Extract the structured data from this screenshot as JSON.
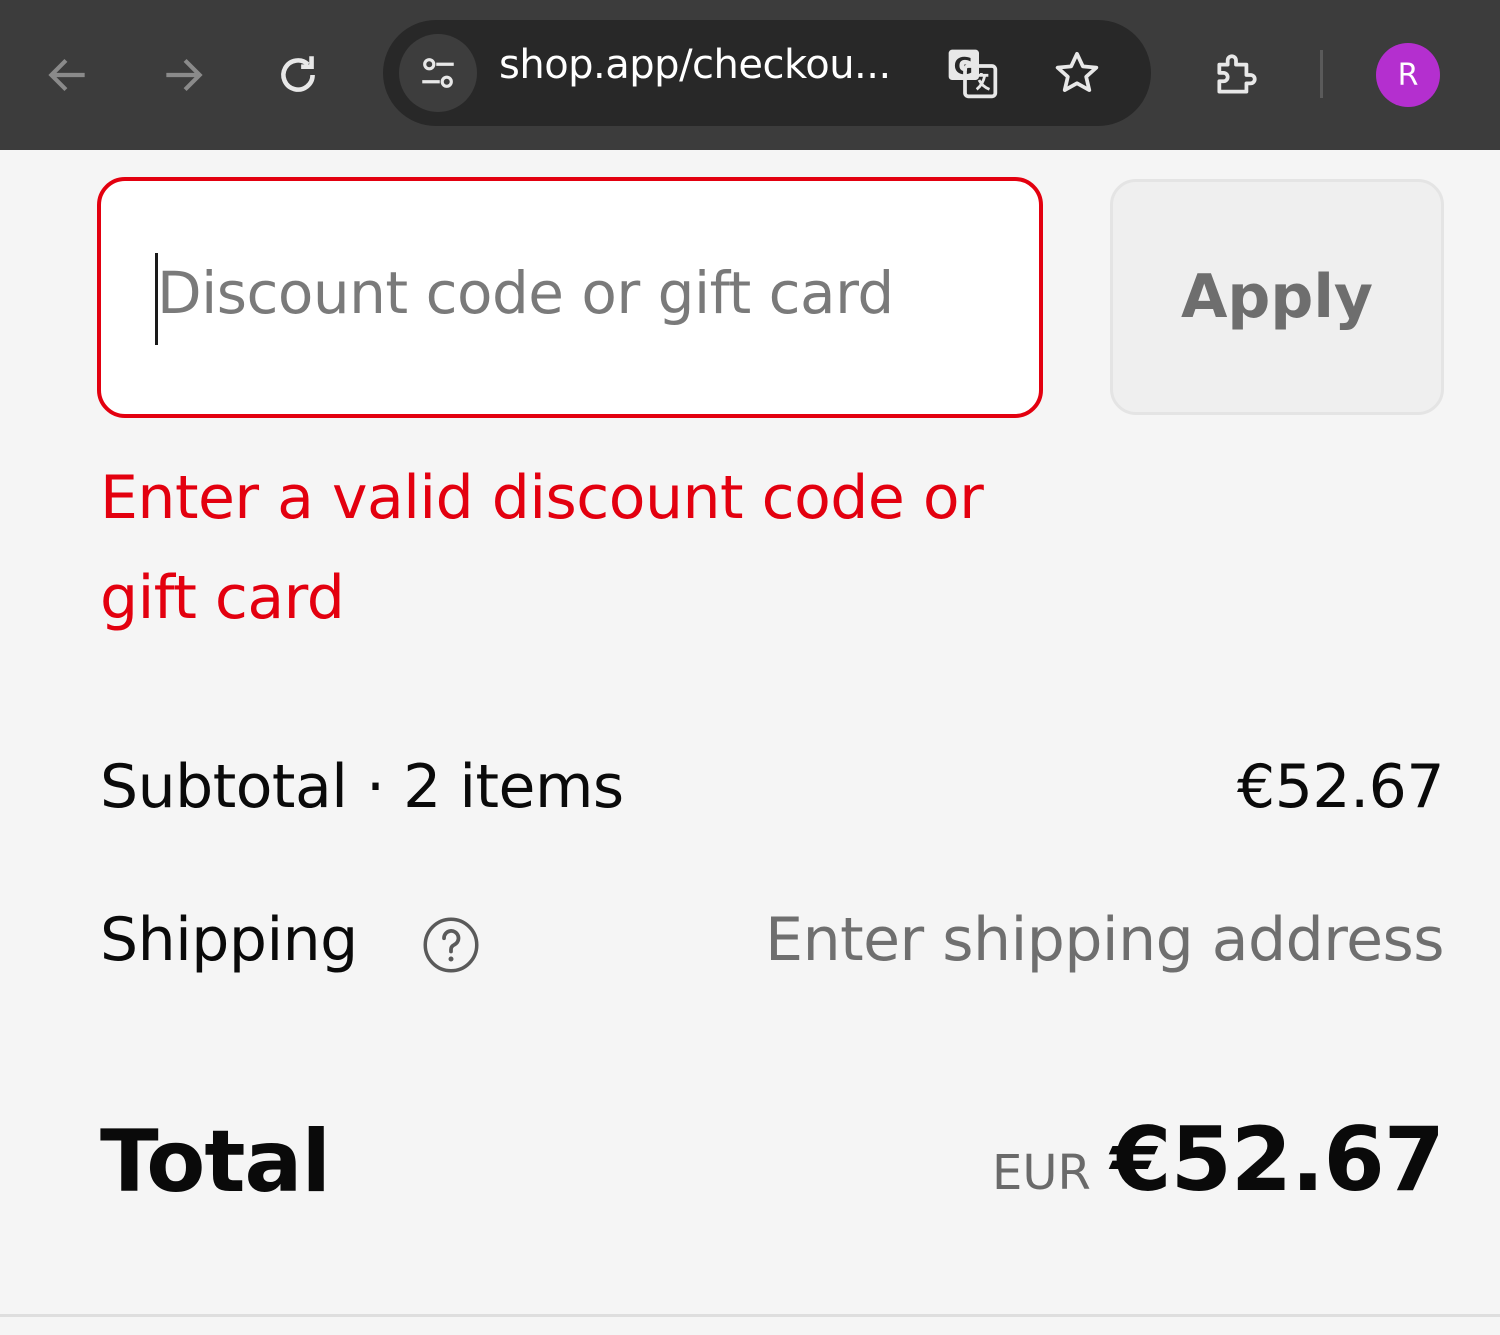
{
  "browser": {
    "url": "shop.app/checkou...",
    "profile_initial": "R",
    "icons": {
      "back": "back-arrow-icon",
      "forward": "forward-arrow-icon",
      "reload": "reload-icon",
      "site_info": "site-info-tune-icon",
      "translate": "translate-icon",
      "bookmark": "star-icon",
      "extensions": "puzzle-icon"
    }
  },
  "discount": {
    "placeholder": "Discount code or gift card",
    "value": "",
    "apply_label": "Apply",
    "error": "Enter a valid discount code or gift card"
  },
  "summary": {
    "subtotal_label": "Subtotal · 2 items",
    "subtotal_value": "€52.67",
    "shipping_label": "Shipping",
    "shipping_value": "Enter shipping address",
    "total_label": "Total",
    "currency": "EUR",
    "total_value": "€52.67"
  },
  "colors": {
    "error": "#e3000f",
    "toolbar": "#3c3c3c",
    "avatar": "#b42fcf"
  }
}
